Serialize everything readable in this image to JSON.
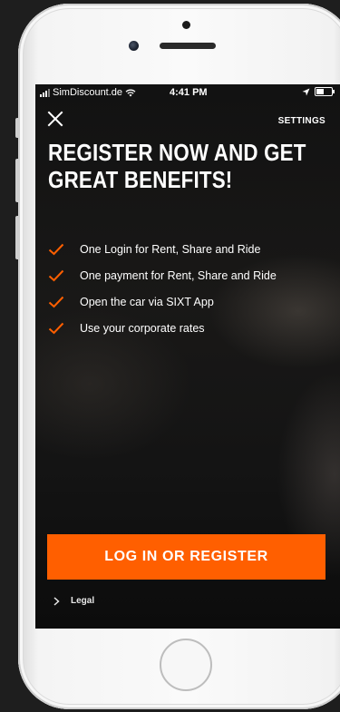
{
  "status_bar": {
    "carrier": "SimDiscount.de",
    "time": "4:41 PM"
  },
  "header": {
    "close_icon": "close-icon",
    "settings_label": "SETTINGS"
  },
  "headline": {
    "line1": "REGISTER NOW AND GET",
    "line2": "GREAT BENEFITS!"
  },
  "benefits": [
    {
      "label": "One Login for Rent, Share and Ride",
      "icon": "check-icon"
    },
    {
      "label": "One payment for Rent, Share and Ride",
      "icon": "check-icon"
    },
    {
      "label": "Open the car via SIXT App",
      "icon": "check-icon"
    },
    {
      "label": "Use your corporate rates",
      "icon": "check-icon"
    }
  ],
  "cta": {
    "label": "LOG IN OR REGISTER"
  },
  "footer": {
    "legal_label": "Legal",
    "legal_icon": "chevron-right-icon"
  },
  "colors": {
    "accent": "#ff5f00",
    "check": "#ff5f00",
    "text": "#ffffff"
  }
}
